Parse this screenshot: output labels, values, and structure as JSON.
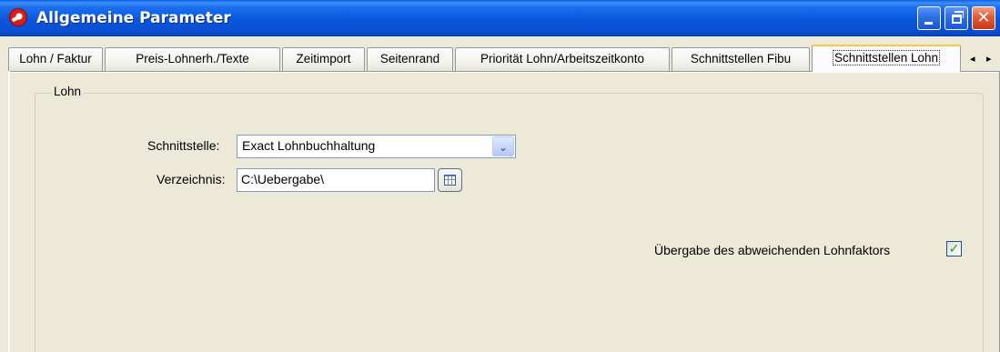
{
  "window": {
    "title": "Allgemeine Parameter",
    "close_glyph": "✕"
  },
  "tabs": [
    {
      "label": "Lohn / Faktur"
    },
    {
      "label": "Preis-Lohnerh./Texte"
    },
    {
      "label": "Zeitimport"
    },
    {
      "label": "Seitenrand"
    },
    {
      "label": "Priorität Lohn/Arbeitszeitkonto"
    },
    {
      "label": "Schnittstellen Fibu"
    },
    {
      "label": "Schnittstellen Lohn",
      "active": true
    }
  ],
  "tab_scroll": {
    "left": "◂",
    "right": "▸"
  },
  "group": {
    "label": "Lohn",
    "schnittstelle_label": "Schnittstelle:",
    "schnittstelle_value": "Exact Lohnbuchhaltung",
    "verzeichnis_label": "Verzeichnis:",
    "verzeichnis_value": "C:\\Uebergabe\\",
    "checkbox_label": "Übergabe des abweichenden Lohnfaktors",
    "checkbox_checked": true,
    "check_glyph": "✓",
    "dropdown_glyph": "⌄"
  },
  "icons": {
    "app": "app-logo-icon",
    "minimize": "minimize-icon",
    "restore": "restore-icon",
    "close": "close-icon",
    "dropdown": "chevron-down-icon",
    "browse": "folder-browse-icon"
  }
}
